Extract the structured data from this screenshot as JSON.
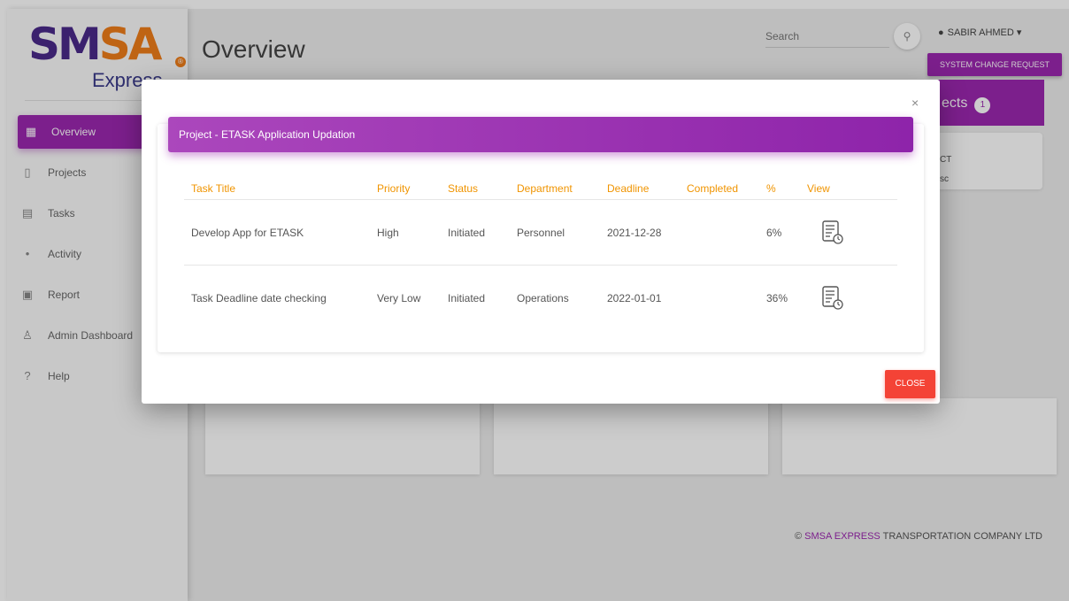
{
  "brand": {
    "logo_main_left": "SM",
    "logo_main_right": "SA",
    "logo_reg": "®",
    "logo_sub": "Express"
  },
  "header": {
    "page_title": "Overview",
    "search_placeholder": "Search",
    "user_name": "SABIR AHMED ▾",
    "system_change_request": "SYSTEM CHANGE REQUEST"
  },
  "sidebar": {
    "items": [
      {
        "label": "Overview",
        "icon": "dashboard-icon",
        "glyph": "▦"
      },
      {
        "label": "Projects",
        "icon": "clipboard-icon",
        "glyph": "▯"
      },
      {
        "label": "Tasks",
        "icon": "list-icon",
        "glyph": "▤"
      },
      {
        "label": "Activity",
        "icon": "bubble-icon",
        "glyph": "•"
      },
      {
        "label": "Report",
        "icon": "badge-icon",
        "glyph": "▣"
      },
      {
        "label": "Admin Dashboard",
        "icon": "person-icon",
        "glyph": "♙"
      },
      {
        "label": "Help",
        "icon": "help-icon",
        "glyph": "?"
      }
    ]
  },
  "background": {
    "projects_card_label": "ects",
    "projects_count": "1",
    "sub_card_line1": "CT",
    "sub_card_line2": "sc"
  },
  "footer": {
    "copyright": "©",
    "company_brand": "SMSA EXPRESS",
    "company_rest": "TRANSPORTATION COMPANY LTD"
  },
  "modal": {
    "close_x": "×",
    "project_header": "Project - ETASK Application Updation",
    "columns": [
      "Task Title",
      "Priority",
      "Status",
      "Department",
      "Deadline",
      "Completed",
      "%",
      "View"
    ],
    "rows": [
      {
        "title": "Develop App for ETASK",
        "priority": "High",
        "status": "Initiated",
        "department": "Personnel",
        "deadline": "2021-12-28",
        "completed": "",
        "pct": "6%"
      },
      {
        "title": "Task Deadline date checking",
        "priority": "Very Low",
        "status": "Initiated",
        "department": "Operations",
        "deadline": "2022-01-01",
        "completed": "",
        "pct": "36%"
      }
    ],
    "close_button": "CLOSE"
  },
  "colors": {
    "accent": "#9c27b0",
    "header_text": "#f09400",
    "close": "#f44336"
  }
}
